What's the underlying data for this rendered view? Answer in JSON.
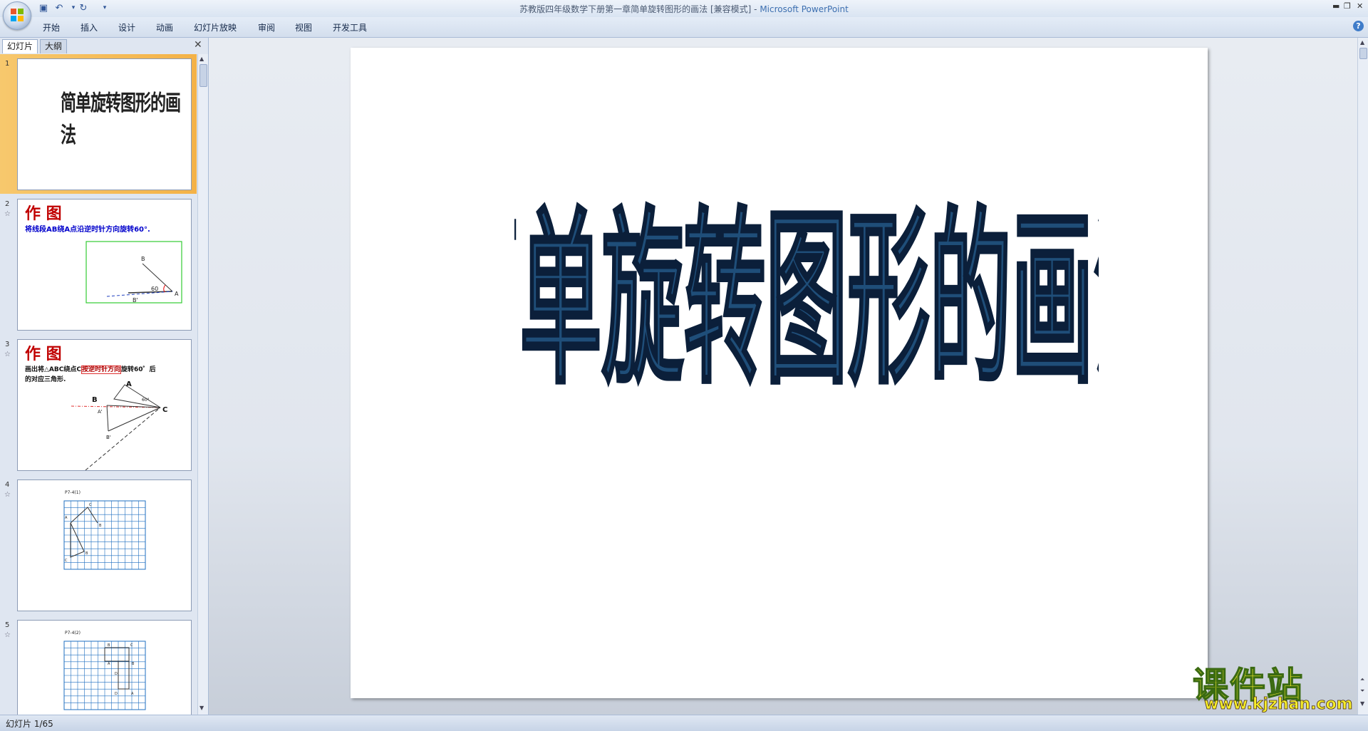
{
  "window": {
    "title": "苏教版四年级数学下册第一章简单旋转图形的画法 [兼容模式]",
    "separator": " - ",
    "app_name": "Microsoft PowerPoint"
  },
  "ribbon": {
    "tabs": [
      "开始",
      "插入",
      "设计",
      "动画",
      "幻灯片放映",
      "审阅",
      "视图",
      "开发工具"
    ]
  },
  "left_pane": {
    "tab_slides": "幻灯片",
    "tab_outline": "大纲",
    "thumbnails": [
      {
        "num": "1",
        "title": "简单旋转图形的画法"
      },
      {
        "num": "2",
        "title": "作 图",
        "text": "将线段AB绕A点沿逆时针方向旋转60°.",
        "labels": [
          "B",
          "60",
          "A",
          "B'"
        ]
      },
      {
        "num": "3",
        "title": "作 图",
        "text_part1": "画出将△ABC绕点C",
        "text_boxed": "按逆时针方向",
        "text_part2": "旋转60゜后",
        "text_line2": "的对应三角形.",
        "labels": [
          "A",
          "B",
          "C",
          "60°",
          "A'",
          "B'"
        ]
      },
      {
        "num": "4",
        "caption": "P7-4(1)",
        "labels": [
          "C",
          "A",
          "B",
          "C",
          "B"
        ]
      },
      {
        "num": "5",
        "caption": "P7-4(2)",
        "labels": [
          "B",
          "C",
          "A",
          "B",
          "D",
          "D",
          "A"
        ]
      }
    ]
  },
  "slide": {
    "title": "简单旋转图形的画法"
  },
  "status": {
    "slide_indicator": "幻灯片 1/65"
  },
  "watermark": {
    "main": "课件站",
    "url": "www.kjzhan.com"
  },
  "colors": {
    "title_fill": "#1f4e79",
    "selected_thumb": "#f4b247",
    "thumb_title_red": "#c00000",
    "thumb_text_blue": "#0000cc"
  }
}
